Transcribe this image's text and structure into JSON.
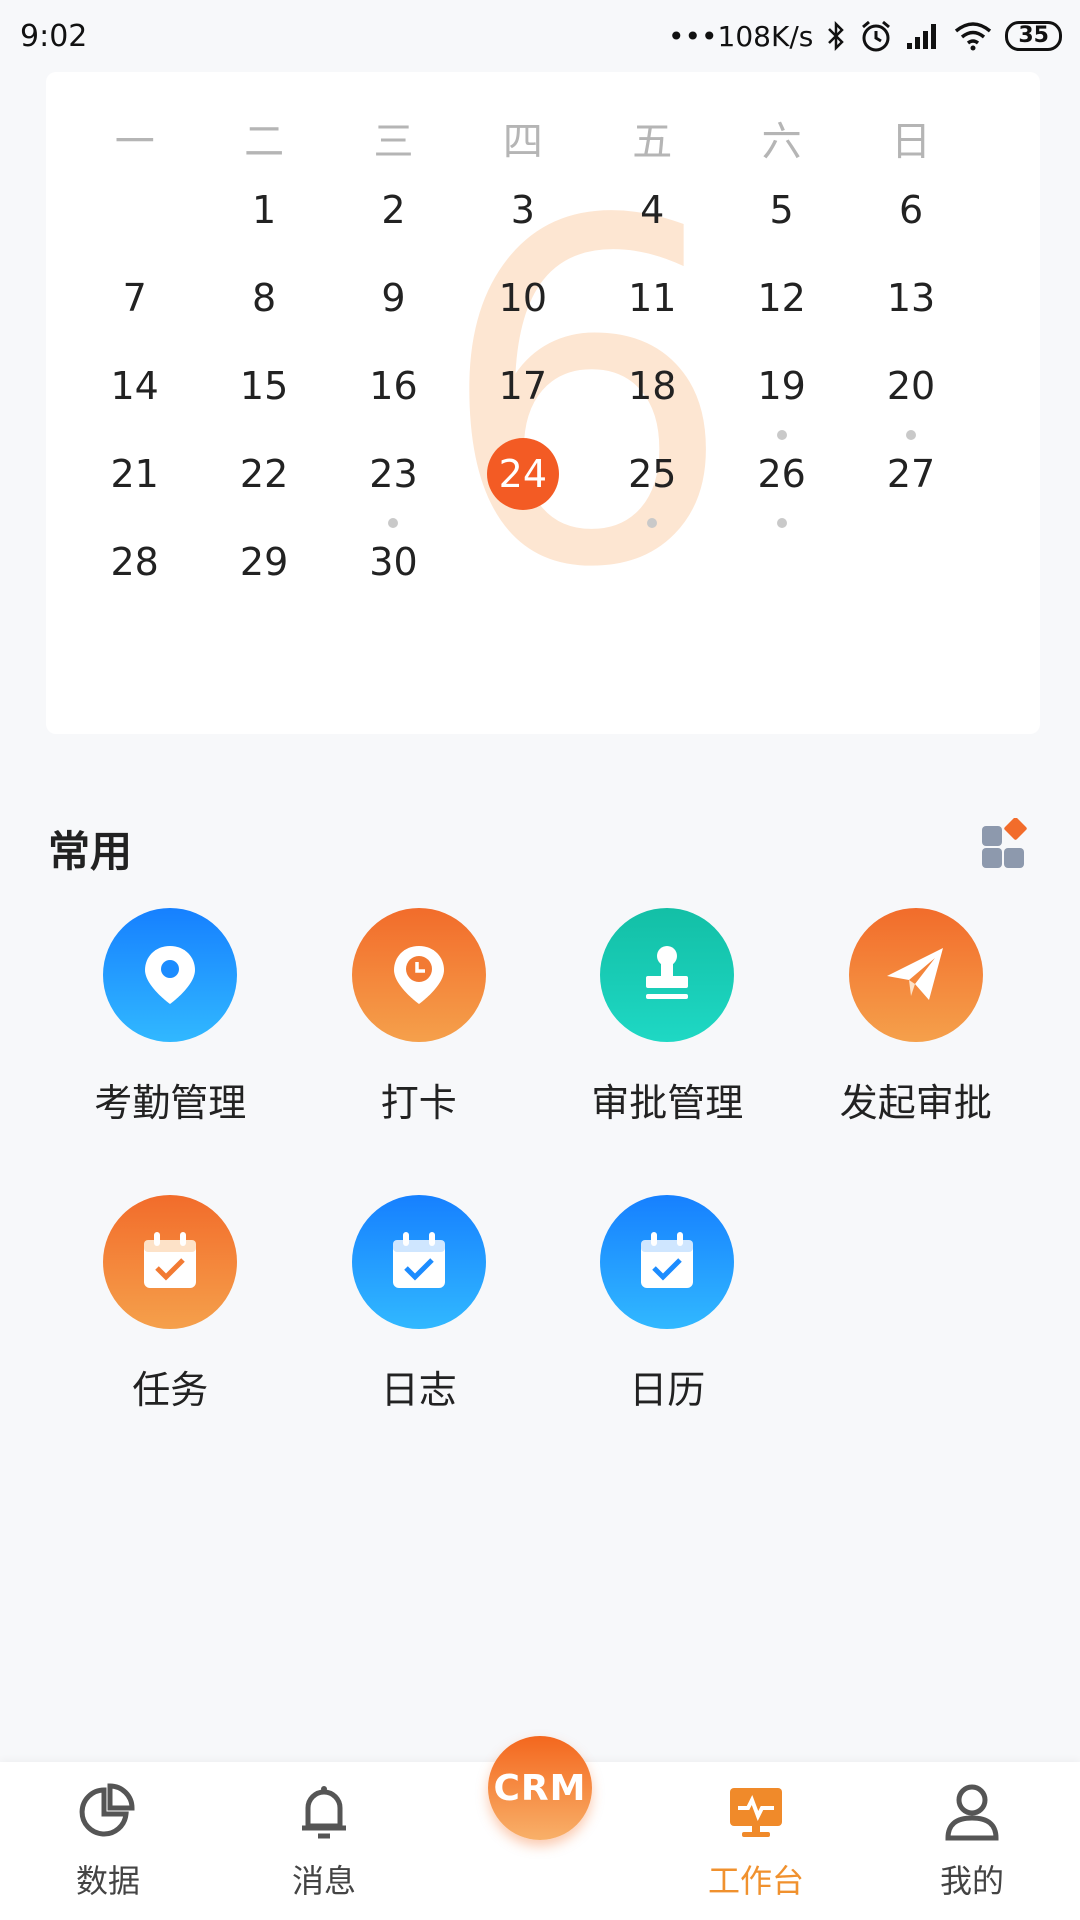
{
  "status_bar": {
    "time": "9:02",
    "network_speed": "108K/s",
    "battery": "35"
  },
  "calendar": {
    "month": "6",
    "weekdays": [
      "一",
      "二",
      "三",
      "四",
      "五",
      "六",
      "日"
    ],
    "today": "24",
    "weeks": [
      [
        {
          "d": ""
        },
        {
          "d": "1"
        },
        {
          "d": "2"
        },
        {
          "d": "3"
        },
        {
          "d": "4"
        },
        {
          "d": "5"
        },
        {
          "d": "6"
        }
      ],
      [
        {
          "d": "7"
        },
        {
          "d": "8"
        },
        {
          "d": "9"
        },
        {
          "d": "10"
        },
        {
          "d": "11"
        },
        {
          "d": "12"
        },
        {
          "d": "13"
        }
      ],
      [
        {
          "d": "14"
        },
        {
          "d": "15"
        },
        {
          "d": "16"
        },
        {
          "d": "17"
        },
        {
          "d": "18"
        },
        {
          "d": "19",
          "dot": true
        },
        {
          "d": "20",
          "dot": true
        }
      ],
      [
        {
          "d": "21"
        },
        {
          "d": "22"
        },
        {
          "d": "23",
          "dot": true
        },
        {
          "d": "24"
        },
        {
          "d": "25",
          "dot": true
        },
        {
          "d": "26",
          "dot": true
        },
        {
          "d": "27"
        }
      ],
      [
        {
          "d": "28"
        },
        {
          "d": "29"
        },
        {
          "d": "30"
        },
        {
          "d": ""
        },
        {
          "d": ""
        },
        {
          "d": ""
        },
        {
          "d": ""
        }
      ]
    ]
  },
  "common": {
    "title": "常用",
    "apps": [
      {
        "label": "考勤管理",
        "icon": "location-pin-icon",
        "color": "blue"
      },
      {
        "label": "打卡",
        "icon": "clock-pin-icon",
        "color": "orange"
      },
      {
        "label": "审批管理",
        "icon": "stamp-icon",
        "color": "teal"
      },
      {
        "label": "发起审批",
        "icon": "paper-plane-icon",
        "color": "orange"
      },
      {
        "label": "任务",
        "icon": "task-calendar-icon",
        "color": "orange"
      },
      {
        "label": "日志",
        "icon": "log-calendar-icon",
        "color": "blue"
      },
      {
        "label": "日历",
        "icon": "calendar-check-icon",
        "color": "blue"
      }
    ]
  },
  "bottom_nav": {
    "items": [
      {
        "label": "数据",
        "icon": "pie-chart-icon"
      },
      {
        "label": "消息",
        "icon": "bell-icon"
      },
      {
        "label": "工作台",
        "icon": "monitor-icon",
        "active": true
      },
      {
        "label": "我的",
        "icon": "user-icon"
      }
    ],
    "center": "CRM"
  },
  "colors": {
    "accent": "#f35b24",
    "nav_active": "#f0912e"
  }
}
